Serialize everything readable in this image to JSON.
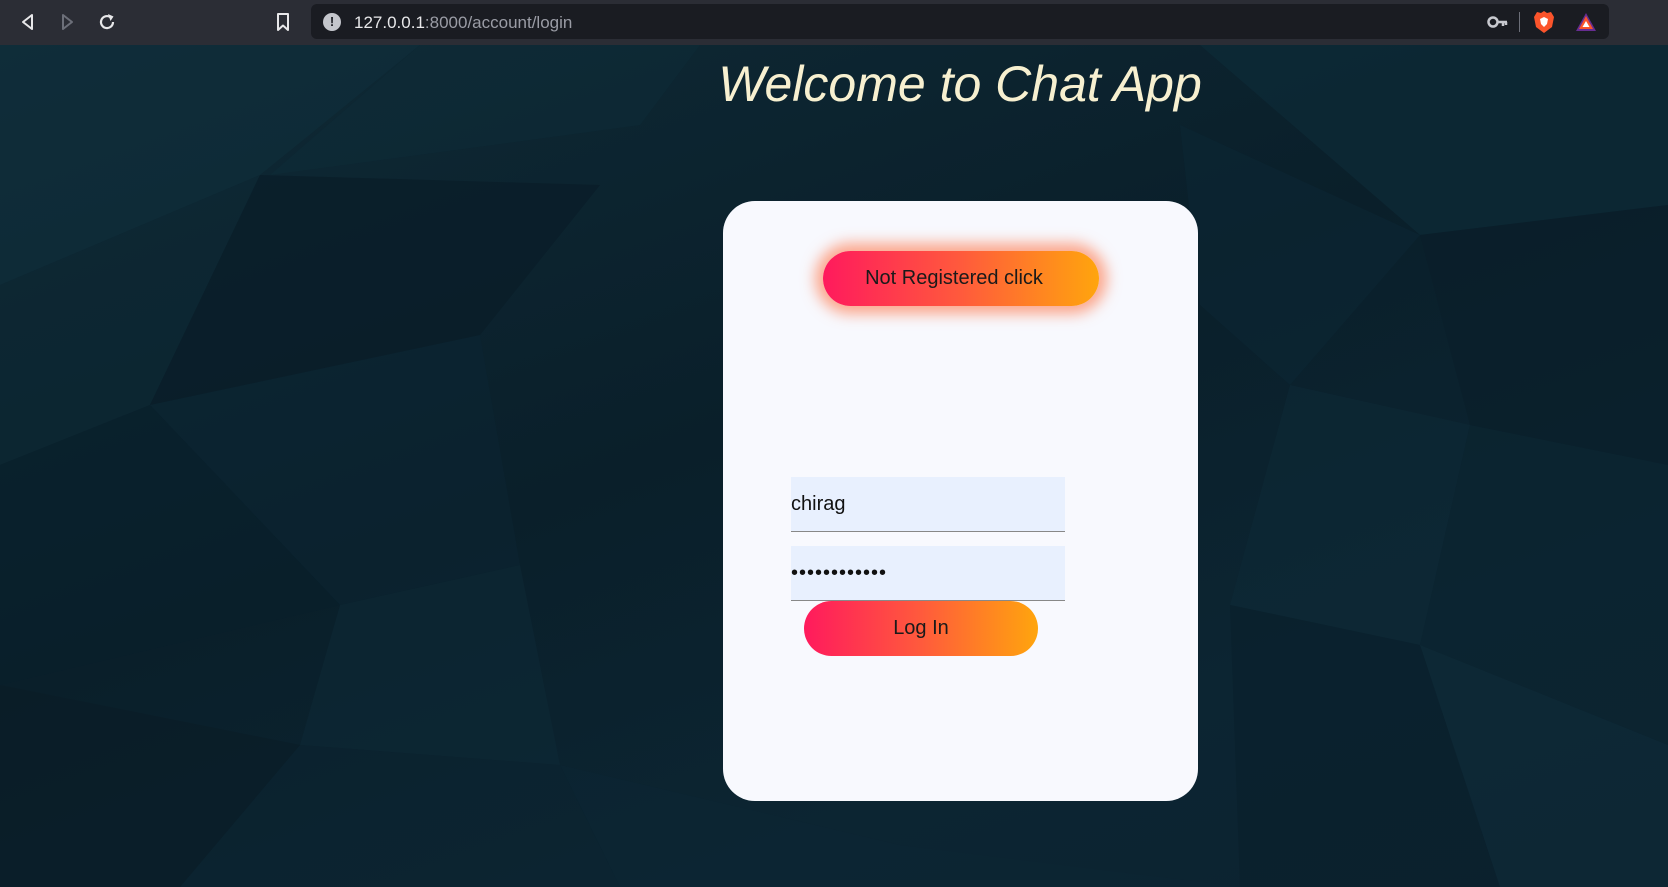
{
  "browser": {
    "url_host": "127.0.0.1",
    "url_path": ":8000/account/login",
    "back_icon": "back-arrow-icon",
    "forward_icon": "forward-arrow-icon",
    "reload_icon": "reload-icon",
    "bookmark_icon": "bookmark-icon",
    "info_icon": "info-icon",
    "info_glyph": "!",
    "key_icon": "key-icon",
    "brave_icon": "brave-lion-icon",
    "rewards_icon": "rewards-triangle-icon"
  },
  "page": {
    "title": "Welcome to Chat App"
  },
  "login_card": {
    "register_button_label": "Not Registered click",
    "username_value": "chirag",
    "password_value": "••••••••••••",
    "login_button_label": "Log In"
  },
  "colors": {
    "toolbar_bg": "#2b2d35",
    "page_bg": "#0b2330",
    "card_bg": "#f8f9fe",
    "gradient_start": "#ff1a5d",
    "gradient_end": "#ffa50d",
    "headline": "#f7f0d0"
  }
}
